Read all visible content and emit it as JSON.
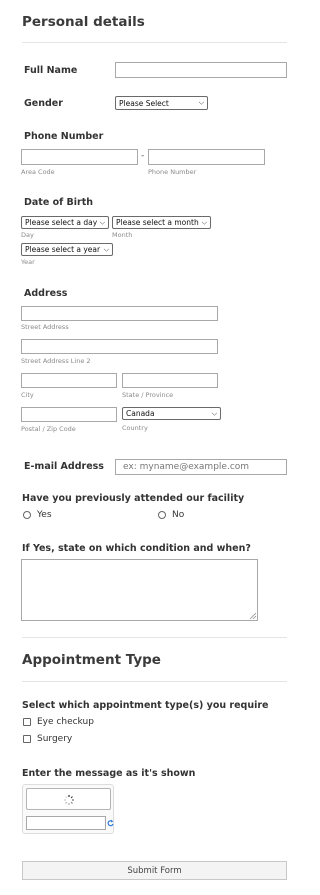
{
  "personal": {
    "title": "Personal details"
  },
  "full_name": {
    "label": "Full Name"
  },
  "gender": {
    "label": "Gender",
    "selected": "Please Select"
  },
  "phone": {
    "label": "Phone Number",
    "dash": "-",
    "area_code": "Area Code",
    "phone_number": "Phone Number"
  },
  "dob": {
    "label": "Date of Birth",
    "day": "Please select a day",
    "month": "Please select a month",
    "year": "Please select a year",
    "day_sub": "Day",
    "month_sub": "Month",
    "year_sub": "Year"
  },
  "address": {
    "label": "Address",
    "street": "Street Address",
    "street2": "Street Address Line 2",
    "city": "City",
    "state": "State / Province",
    "postal": "Postal / Zip Code",
    "country_sub": "Country",
    "country_selected": "Canada"
  },
  "email": {
    "label": "E-mail Address",
    "placeholder": "ex: myname@example.com"
  },
  "attended": {
    "question": "Have you previously attended our facility",
    "yes": "Yes",
    "no": "No"
  },
  "condition": {
    "question": "If Yes, state on which condition and when?"
  },
  "appointment": {
    "title": "Appointment Type",
    "question": "Select which appointment type(s) you require",
    "options": [
      "Eye checkup",
      "Surgery"
    ]
  },
  "captcha": {
    "question": "Enter the message as it's shown"
  },
  "submit": {
    "label": "Submit Form"
  }
}
